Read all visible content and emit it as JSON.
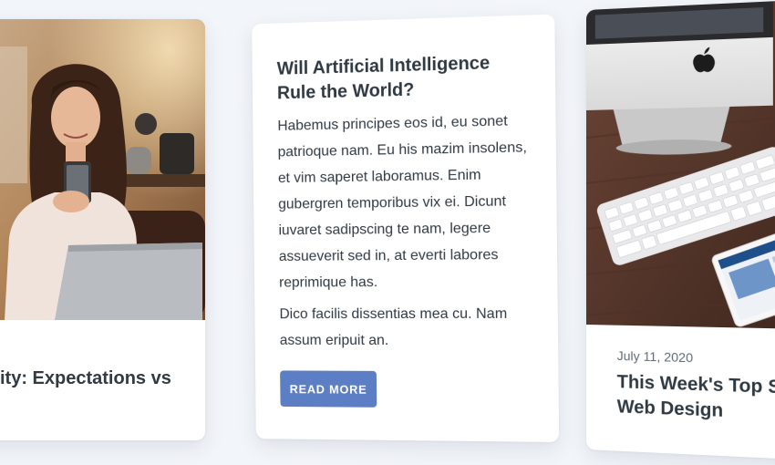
{
  "cards": [
    {
      "title": "ity: Expectations vs",
      "image": "woman-with-smartphone-and-laptop"
    },
    {
      "title": "Will Artificial Intelligence Rule the World?",
      "paragraphs": [
        "Habemus principes eos id, eu sonet patrioque nam. Eu his mazim insolens, et vim saperet laboramus. Enim gubergren temporibus vix ei. Dicunt iuvaret sadipscing te nam, legere assueverit sed in, at everti labores reprimique has.",
        "Dico facilis dissentias mea cu. Nam assum eripuit an."
      ],
      "button_label": "READ MORE"
    },
    {
      "date": "July 11, 2020",
      "title": "This Week's Top St\nWeb Design",
      "image": "imac-keyboard-and-tablet-on-desk"
    }
  ],
  "colors": {
    "background": "#f2f5f9",
    "card": "#ffffff",
    "title_text": "#2f3942",
    "button": "#5b7ec4"
  }
}
